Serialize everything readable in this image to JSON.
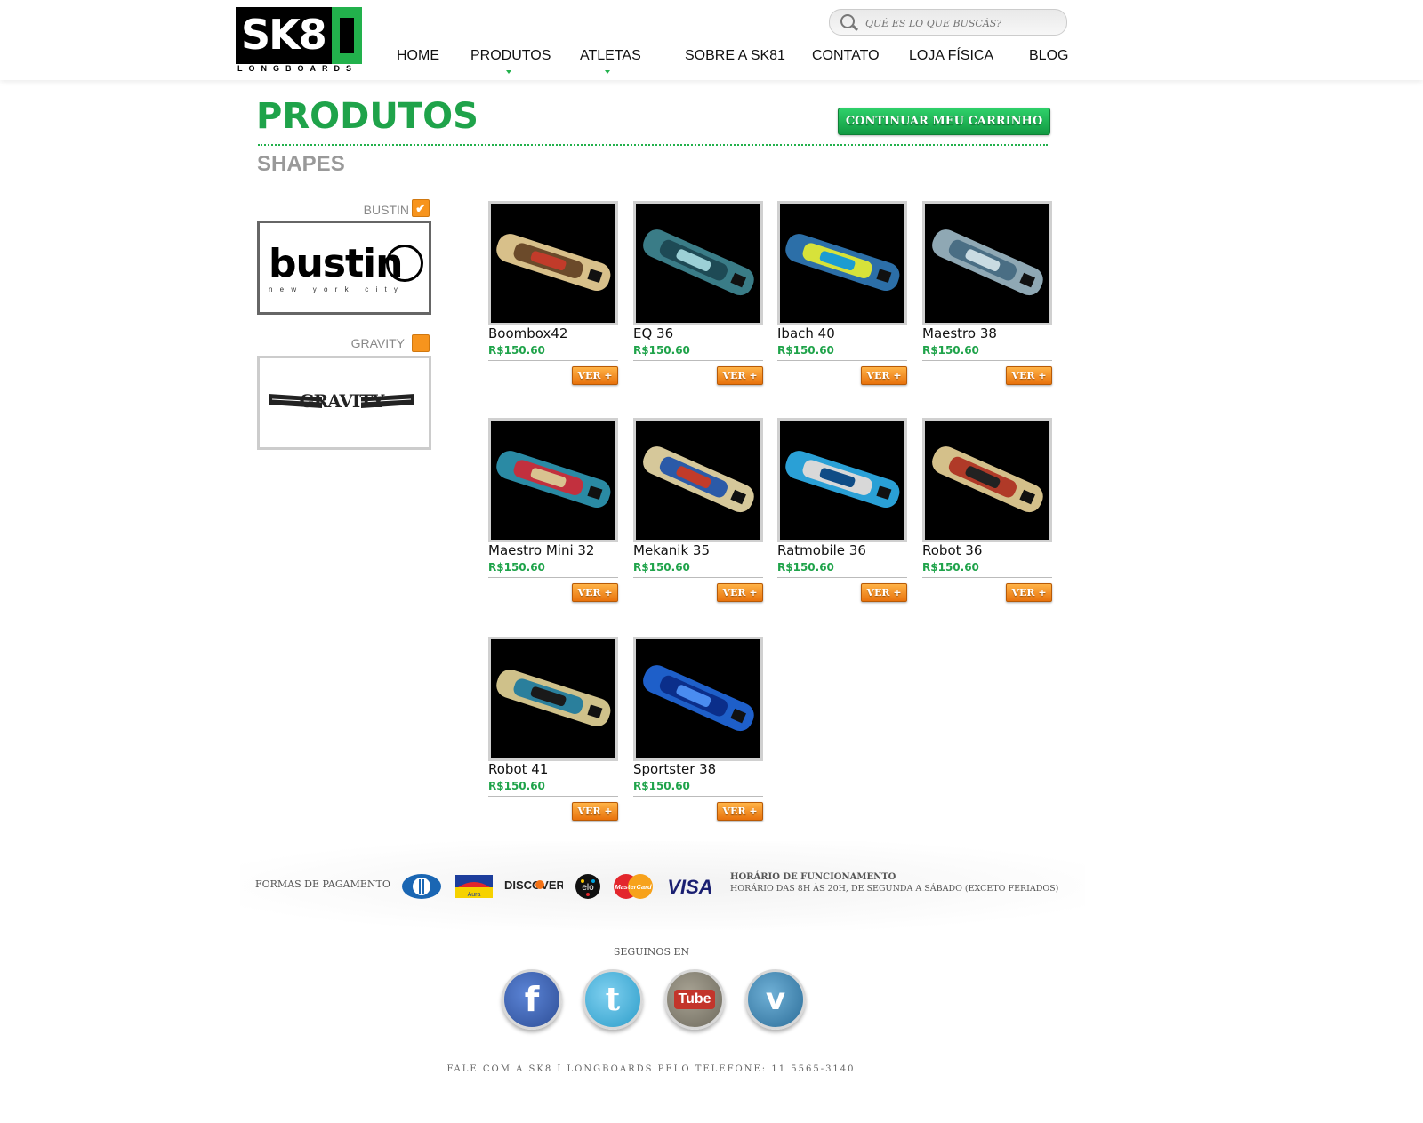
{
  "header": {
    "logo_text": "SK8",
    "logo_subtitle": "LONGBOARDS",
    "search_placeholder": "QUÉ ES LO QUE BUSCÁS?",
    "nav": [
      "HOME",
      "PRODUTOS",
      "ATLETAS",
      "SOBRE A SK81",
      "CONTATO",
      "LOJA FÍSICA",
      "BLOG"
    ]
  },
  "page": {
    "title": "PRODUTOS",
    "cart_button": "CONTINUAR MEU CARRINHO",
    "section": "SHAPES"
  },
  "brands": [
    {
      "label": "BUSTIN",
      "checked": true,
      "logo_text": "bustin",
      "logo_sub": "n e w   y o r k   c i t y"
    },
    {
      "label": "GRAVITY",
      "checked": false,
      "logo_text": "GRAVITY"
    }
  ],
  "products": [
    {
      "name": "Boombox42",
      "price": "R$150.60",
      "button": "VER +"
    },
    {
      "name": "EQ 36",
      "price": "R$150.60",
      "button": "VER +"
    },
    {
      "name": "Ibach 40",
      "price": "R$150.60",
      "button": "VER +"
    },
    {
      "name": "Maestro 38",
      "price": "R$150.60",
      "button": "VER +"
    },
    {
      "name": "Maestro Mini 32",
      "price": "R$150.60",
      "button": "VER +"
    },
    {
      "name": "Mekanik 35",
      "price": "R$150.60",
      "button": "VER +"
    },
    {
      "name": "Ratmobile 36",
      "price": "R$150.60",
      "button": "VER +"
    },
    {
      "name": "Robot 36",
      "price": "R$150.60",
      "button": "VER +"
    },
    {
      "name": "Robot 41",
      "price": "R$150.60",
      "button": "VER +"
    },
    {
      "name": "Sportster 38",
      "price": "R$150.60",
      "button": "VER +"
    }
  ],
  "footer": {
    "payment_label": "FORMAS DE PAGAMENTO",
    "payment_methods": [
      "Diners",
      "Aura",
      "DISCOVER",
      "elo",
      "MasterCard",
      "VISA"
    ],
    "hours_title": "HORÁRIO DE FUNCIONAMENTO",
    "hours_text": "HORÁRIO DAS 8H ÀS 20H, DE SEGUNDA A SÁBADO (EXCETO FERIADOS)",
    "follow_label": "SEGUINOS EN",
    "social": [
      "facebook-icon",
      "twitter-icon",
      "youtube-icon",
      "vimeo-icon"
    ],
    "phone_text": "FALE COM A SK8 I LONGBOARDS PELO TELEFONE: 11 5565-3140"
  },
  "colors": {
    "brand_green": "#1fa34a",
    "accent_orange": "#f7941d"
  }
}
